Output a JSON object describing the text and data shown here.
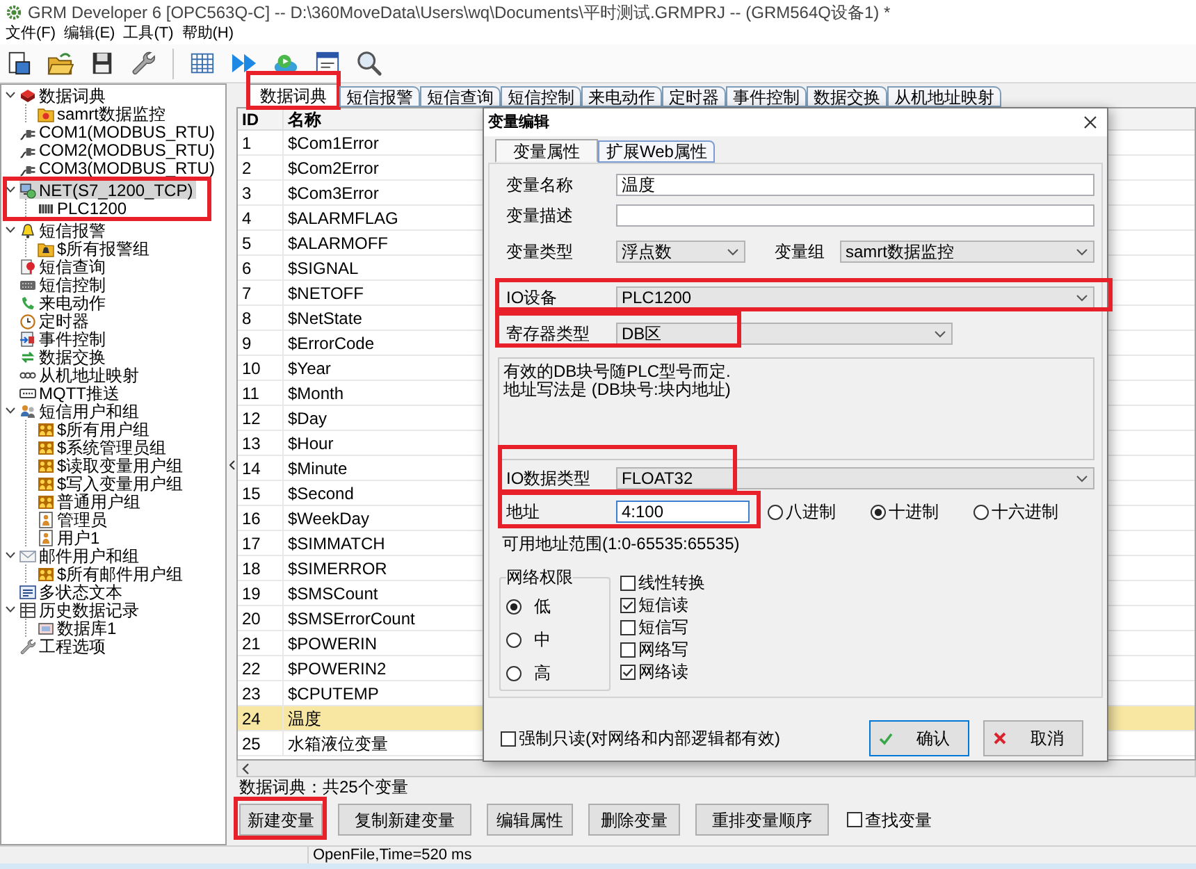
{
  "window": {
    "title": "GRM Developer 6 [OPC563Q-C] -- D:\\360MoveData\\Users\\wq\\Documents\\平时测试.GRMPRJ -- (GRM564Q设备1) *"
  },
  "menu": [
    "文件(F)",
    "编辑(E)",
    "工具(T)",
    "帮助(H)"
  ],
  "tree": [
    {
      "label": "数据词典",
      "kind": "dictionary",
      "expanded": true,
      "selected": false,
      "highlighted": false,
      "children": [
        {
          "label": "samrt数据监控",
          "kind": "group",
          "selected": false,
          "highlighted": false
        }
      ]
    },
    {
      "label": "COM1(MODBUS_RTU)",
      "kind": "port",
      "selected": false,
      "highlighted": false
    },
    {
      "label": "COM2(MODBUS_RTU)",
      "kind": "port",
      "selected": false,
      "highlighted": false
    },
    {
      "label": "COM3(MODBUS_RTU)",
      "kind": "port",
      "selected": false,
      "highlighted": false
    },
    {
      "label": "NET(S7_1200_TCP)",
      "kind": "network",
      "expanded": true,
      "selected": true,
      "highlighted": true,
      "children": [
        {
          "label": "PLC1200",
          "kind": "device",
          "selected": false,
          "highlighted": false
        }
      ]
    },
    {
      "label": "短信报警",
      "kind": "alarm",
      "expanded": true,
      "selected": false,
      "highlighted": false,
      "children": [
        {
          "label": "$所有报警组",
          "kind": "alarmgroup",
          "selected": false,
          "highlighted": false
        }
      ]
    },
    {
      "label": "短信查询",
      "kind": "query",
      "selected": false,
      "highlighted": false
    },
    {
      "label": "短信控制",
      "kind": "control",
      "selected": false,
      "highlighted": false
    },
    {
      "label": "来电动作",
      "kind": "call",
      "selected": false,
      "highlighted": false
    },
    {
      "label": "定时器",
      "kind": "timer",
      "selected": false,
      "highlighted": false
    },
    {
      "label": "事件控制",
      "kind": "event",
      "selected": false,
      "highlighted": false
    },
    {
      "label": "数据交换",
      "kind": "exchange",
      "selected": false,
      "highlighted": false
    },
    {
      "label": "从机地址映射",
      "kind": "mapping",
      "selected": false,
      "highlighted": false
    },
    {
      "label": "MQTT推送",
      "kind": "mqtt",
      "selected": false,
      "highlighted": false
    },
    {
      "label": "短信用户和组",
      "kind": "users",
      "expanded": true,
      "selected": false,
      "highlighted": false,
      "children": [
        {
          "label": "$所有用户组",
          "kind": "usergroup",
          "selected": false,
          "highlighted": false
        },
        {
          "label": "$系统管理员组",
          "kind": "usergroup",
          "selected": false,
          "highlighted": false
        },
        {
          "label": "$读取变量用户组",
          "kind": "usergroup",
          "selected": false,
          "highlighted": false
        },
        {
          "label": "$写入变量用户组",
          "kind": "usergroup",
          "selected": false,
          "highlighted": false
        },
        {
          "label": "普通用户组",
          "kind": "usergroup",
          "selected": false,
          "highlighted": false
        },
        {
          "label": "管理员",
          "kind": "user",
          "selected": false,
          "highlighted": false
        },
        {
          "label": "用户1",
          "kind": "user",
          "selected": false,
          "highlighted": false
        }
      ]
    },
    {
      "label": "邮件用户和组",
      "kind": "mail",
      "expanded": true,
      "selected": false,
      "highlighted": false,
      "children": [
        {
          "label": "$所有邮件用户组",
          "kind": "usergroup",
          "selected": false,
          "highlighted": false
        }
      ]
    },
    {
      "label": "多状态文本",
      "kind": "text",
      "selected": false,
      "highlighted": false
    },
    {
      "label": "历史数据记录",
      "kind": "history",
      "expanded": true,
      "selected": false,
      "highlighted": false,
      "children": [
        {
          "label": "数据库1",
          "kind": "database",
          "selected": false,
          "highlighted": false
        }
      ]
    },
    {
      "label": "工程选项",
      "kind": "options",
      "selected": false,
      "highlighted": false
    }
  ],
  "tabs": [
    {
      "label": "数据词典",
      "selected": true,
      "highlighted": true
    },
    {
      "label": "短信报警",
      "selected": false,
      "highlighted": false
    },
    {
      "label": "短信查询",
      "selected": false,
      "highlighted": false
    },
    {
      "label": "短信控制",
      "selected": false,
      "highlighted": false
    },
    {
      "label": "来电动作",
      "selected": false,
      "highlighted": false
    },
    {
      "label": "定时器",
      "selected": false,
      "highlighted": false
    },
    {
      "label": "事件控制",
      "selected": false,
      "highlighted": false
    },
    {
      "label": "数据交换",
      "selected": false,
      "highlighted": false
    },
    {
      "label": "从机地址映射",
      "selected": false,
      "highlighted": false
    }
  ],
  "table": {
    "columns": [
      "ID",
      "名称"
    ],
    "rows": [
      {
        "cells": [
          "1",
          "$Com1Error"
        ],
        "selected": false
      },
      {
        "cells": [
          "2",
          "$Com2Error"
        ],
        "selected": false
      },
      {
        "cells": [
          "3",
          "$Com3Error"
        ],
        "selected": false
      },
      {
        "cells": [
          "4",
          "$ALARMFLAG"
        ],
        "selected": false
      },
      {
        "cells": [
          "5",
          "$ALARMOFF"
        ],
        "selected": false
      },
      {
        "cells": [
          "6",
          "$SIGNAL"
        ],
        "selected": false
      },
      {
        "cells": [
          "7",
          "$NETOFF"
        ],
        "selected": false
      },
      {
        "cells": [
          "8",
          "$NetState"
        ],
        "selected": false
      },
      {
        "cells": [
          "9",
          "$ErrorCode"
        ],
        "selected": false
      },
      {
        "cells": [
          "10",
          "$Year"
        ],
        "selected": false
      },
      {
        "cells": [
          "11",
          "$Month"
        ],
        "selected": false
      },
      {
        "cells": [
          "12",
          "$Day"
        ],
        "selected": false
      },
      {
        "cells": [
          "13",
          "$Hour"
        ],
        "selected": false
      },
      {
        "cells": [
          "14",
          "$Minute"
        ],
        "selected": false
      },
      {
        "cells": [
          "15",
          "$Second"
        ],
        "selected": false
      },
      {
        "cells": [
          "16",
          "$WeekDay"
        ],
        "selected": false
      },
      {
        "cells": [
          "17",
          "$SIMMATCH"
        ],
        "selected": false
      },
      {
        "cells": [
          "18",
          "$SIMERROR"
        ],
        "selected": false
      },
      {
        "cells": [
          "19",
          "$SMSCount"
        ],
        "selected": false
      },
      {
        "cells": [
          "20",
          "$SMSErrorCount"
        ],
        "selected": false
      },
      {
        "cells": [
          "21",
          "$POWERIN"
        ],
        "selected": false
      },
      {
        "cells": [
          "22",
          "$POWERIN2"
        ],
        "selected": false
      },
      {
        "cells": [
          "23",
          "$CPUTEMP"
        ],
        "selected": false
      },
      {
        "cells": [
          "24",
          "温度"
        ],
        "selected": true
      },
      {
        "cells": [
          "25",
          "水箱液位变量"
        ],
        "selected": false
      }
    ]
  },
  "summary": "数据词典：共25个变量",
  "buttons": [
    {
      "label": "新建变量",
      "highlighted": true
    },
    {
      "label": "复制新建变量",
      "highlighted": false
    },
    {
      "label": "编辑属性",
      "highlighted": false
    },
    {
      "label": "删除变量",
      "highlighted": false
    },
    {
      "label": "重排变量顺序",
      "highlighted": false
    }
  ],
  "find_checkbox": {
    "label": "查找变量",
    "checked": false
  },
  "status_bar": {
    "text": "OpenFile,Time=520 ms"
  },
  "dialog": {
    "title": "变量编辑",
    "tabs": [
      {
        "label": "变量属性",
        "selected": true
      },
      {
        "label": "扩展Web属性",
        "selected": false
      }
    ],
    "variable_name": {
      "label": "变量名称",
      "value": "温度"
    },
    "description": {
      "label": "变量描述"
    },
    "variable_type": {
      "label": "变量类型",
      "value": "浮点数"
    },
    "variable_group": {
      "label": "变量组",
      "value": "samrt数据监控"
    },
    "io_device": {
      "label": "IO设备",
      "value": "PLC1200",
      "highlighted": true
    },
    "register_type": {
      "label": "寄存器类型",
      "value": "DB区",
      "highlighted": true
    },
    "info_text": [
      "有效的DB块号随PLC型号而定.",
      "地址写法是 (DB块号:块内地址)"
    ],
    "io_data_type": {
      "label": "IO数据类型",
      "value": "FLOAT32",
      "highlighted": true
    },
    "address": {
      "label": "地址",
      "value": "4:100",
      "focused": true,
      "highlighted": true
    },
    "radix": [
      {
        "label": "八进制",
        "selected": false
      },
      {
        "label": "十进制",
        "selected": true
      },
      {
        "label": "十六进制",
        "selected": false
      }
    ],
    "address_range": "可用地址范围(1:0-65535:65535)",
    "network_permission": {
      "title": "网络权限",
      "options": [
        {
          "label": "低",
          "selected": true
        },
        {
          "label": "中",
          "selected": false
        },
        {
          "label": "高",
          "selected": false
        }
      ]
    },
    "options": [
      {
        "label": "线性转换",
        "checked": false
      },
      {
        "label": "短信读",
        "checked": true
      },
      {
        "label": "短信写",
        "checked": false
      },
      {
        "label": "网络写",
        "checked": false
      },
      {
        "label": "网络读",
        "checked": true
      }
    ],
    "force_readonly": {
      "label": "强制只读(对网络和内部逻辑都有效)",
      "checked": false
    },
    "buttons": [
      {
        "label": "确认",
        "kind": "ok"
      },
      {
        "label": "取消",
        "kind": "cancel"
      }
    ]
  }
}
